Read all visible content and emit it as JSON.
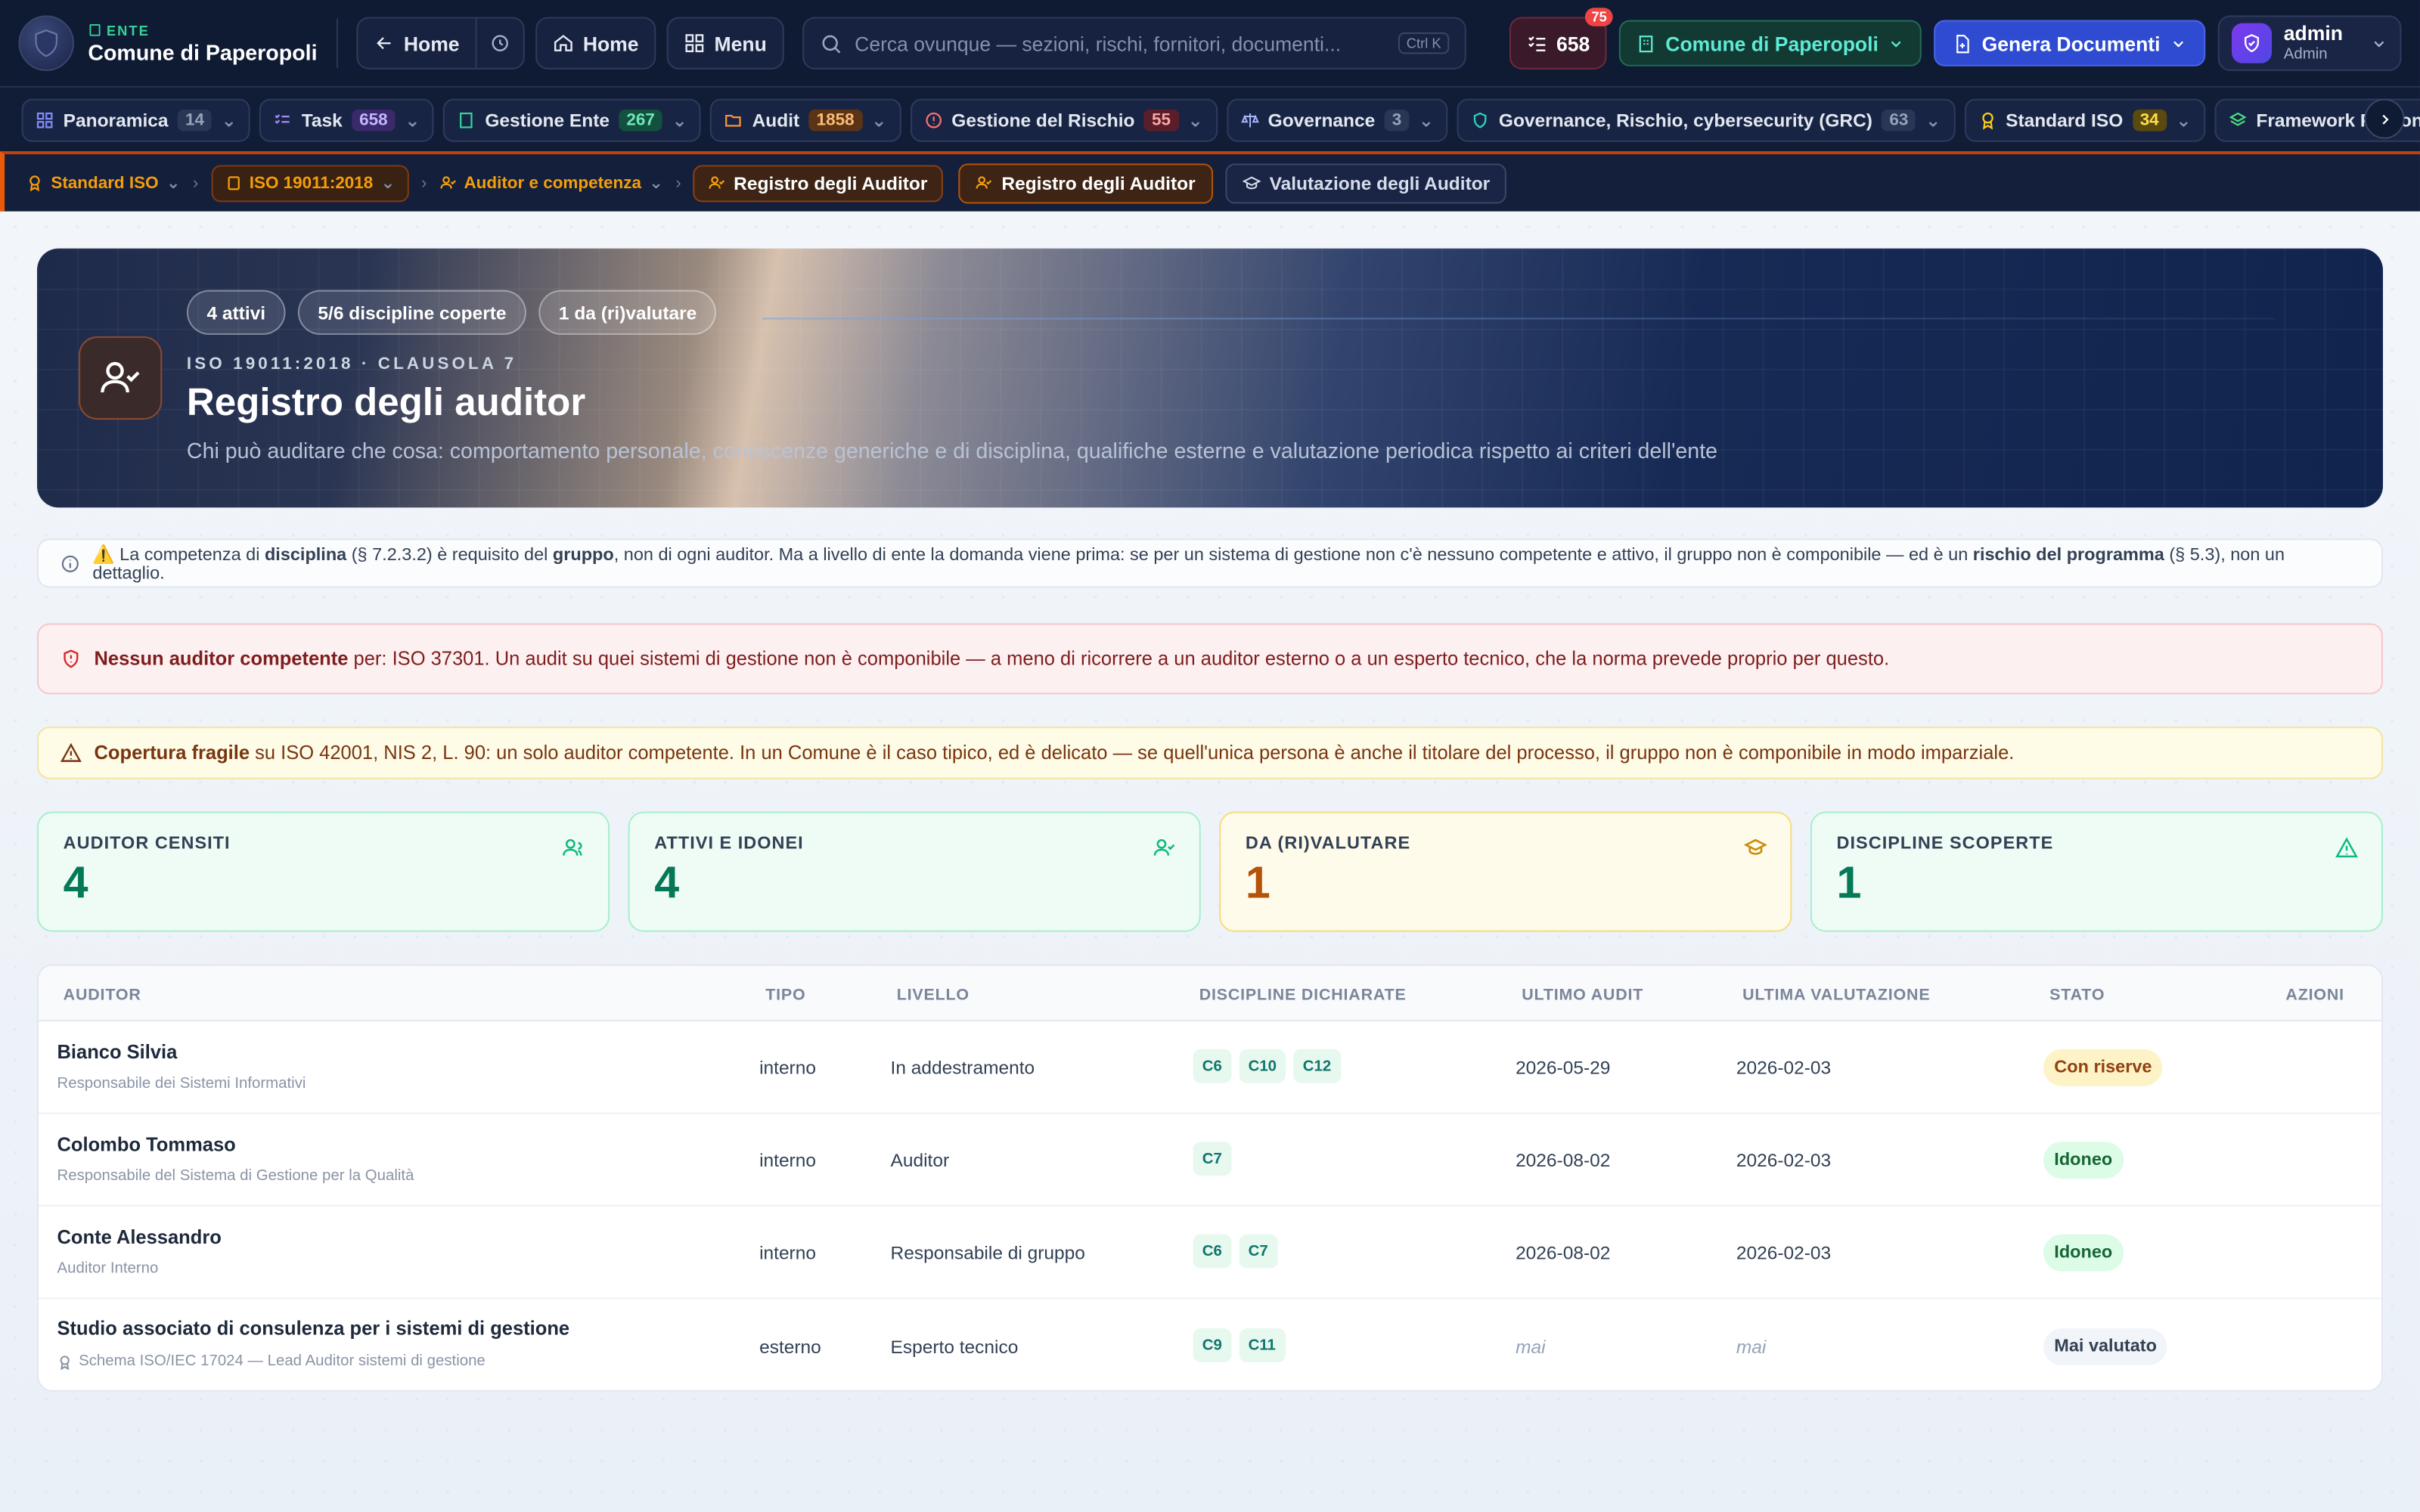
{
  "topbar": {
    "ente_label": "ENTE",
    "ente_name": "Comune di Paperopoli",
    "back_label": "Home",
    "home_label": "Home",
    "menu_label": "Menu",
    "search_placeholder": "Cerca ovunque — sezioni, rischi, fornitori, documenti...",
    "search_shortcut": "Ctrl K",
    "tasks_count": "658",
    "tasks_badge": "75",
    "comune_label": "Comune di Paperopoli",
    "genera_label": "Genera Documenti",
    "user_name": "admin",
    "user_role": "Admin"
  },
  "nav2": [
    {
      "label": "Panoramica",
      "count": "14",
      "color": "#94a3b8"
    },
    {
      "label": "Task",
      "count": "658",
      "color": "#a78bfa"
    },
    {
      "label": "Gestione Ente",
      "count": "267",
      "color": "#34d399"
    },
    {
      "label": "Audit",
      "count": "1858",
      "color": "#fb923c"
    },
    {
      "label": "Gestione del Rischio",
      "count": "55",
      "color": "#f87171"
    },
    {
      "label": "Governance",
      "count": "3",
      "color": "#94a3b8"
    },
    {
      "label": "Governance, Rischio, cybersecurity (GRC)",
      "count": "63",
      "color": "#94a3b8"
    },
    {
      "label": "Standard ISO",
      "count": "34",
      "color": "#facc15"
    },
    {
      "label": "Framework Personalizzati",
      "count": "",
      "color": "#94a3b8"
    }
  ],
  "breadcrumb": {
    "l1": "Standard ISO",
    "l2": "ISO 19011:2018",
    "l3": "Auditor e competenza",
    "current": "Registro degli Auditor",
    "tab_active": "Registro degli Auditor",
    "tab_other": "Valutazione degli Auditor"
  },
  "hero": {
    "chips": [
      "4 attivi",
      "5/6 discipline coperte",
      "1 da (ri)valutare"
    ],
    "kicker": "ISO 19011:2018 · CLAUSOLA 7",
    "title": "Registro degli auditor",
    "subtitle": "Chi può auditare che cosa: comportamento personale, conoscenze generiche e di disciplina, qualifiche esterne e valutazione periodica rispetto ai criteri dell'ente"
  },
  "notes": {
    "info": {
      "t1": "⚠️ La competenza di ",
      "b1": "disciplina",
      "t2": " (§ 7.2.3.2) è requisito del ",
      "b2": "gruppo",
      "t3": ", non di ogni auditor. Ma a livello di ente la domanda viene prima: se per un sistema di gestione non c'è nessuno competente e attivo, il gruppo non è componibile — ed è un ",
      "b3": "rischio del programma",
      "t4": " (§ 5.3), non un dettaglio."
    },
    "danger": {
      "bold": "Nessun auditor competente",
      "text": " per: ISO 37301. Un audit su quei sistemi di gestione non è componibile — a meno di ricorrere a un auditor esterno o a un esperto tecnico, che la norma prevede proprio per questo."
    },
    "warning": {
      "bold": "Copertura fragile",
      "text": " su ISO 42001, NIS 2, L. 90: un solo auditor competente. In un Comune è il caso tipico, ed è delicato — se quell'unica persona è anche il titolare del processo, il gruppo non è componibile in modo imparziale."
    }
  },
  "kpis": [
    {
      "label": "AUDITOR CENSITI",
      "value": "4"
    },
    {
      "label": "ATTIVI E IDONEI",
      "value": "4"
    },
    {
      "label": "DA (RI)VALUTARE",
      "value": "1"
    },
    {
      "label": "DISCIPLINE SCOPERTE",
      "value": "1"
    }
  ],
  "table": {
    "headers": [
      "AUDITOR",
      "TIPO",
      "LIVELLO",
      "DISCIPLINE DICHIARATE",
      "ULTIMO AUDIT",
      "ULTIMA VALUTAZIONE",
      "STATO",
      "AZIONI"
    ],
    "rows": [
      {
        "name": "Bianco Silvia",
        "role": "Responsabile dei Sistemi Informativi",
        "tipo": "interno",
        "livello": "In addestramento",
        "tags": [
          "C6",
          "C10",
          "C12"
        ],
        "audit": "2026-05-29",
        "val": "2026-02-03",
        "stato": "Con riserve"
      },
      {
        "name": "Colombo Tommaso",
        "role": "Responsabile del Sistema di Gestione per la Qualità",
        "tipo": "interno",
        "livello": "Auditor",
        "tags": [
          "C7"
        ],
        "audit": "2026-08-02",
        "val": "2026-02-03",
        "stato": "Idoneo"
      },
      {
        "name": "Conte Alessandro",
        "role": "Auditor Interno",
        "tipo": "interno",
        "livello": "Responsabile di gruppo",
        "tags": [
          "C6",
          "C7"
        ],
        "audit": "2026-08-02",
        "val": "2026-02-03",
        "stato": "Idoneo"
      },
      {
        "name": "Studio associato di consulenza per i sistemi di gestione",
        "role": "Schema ISO/IEC 17024 — Lead Auditor sistemi di gestione",
        "tipo": "esterno",
        "livello": "Esperto tecnico",
        "tags": [
          "C9",
          "C11"
        ],
        "audit": "mai",
        "val": "mai",
        "stato": "Mai valutato"
      }
    ]
  }
}
